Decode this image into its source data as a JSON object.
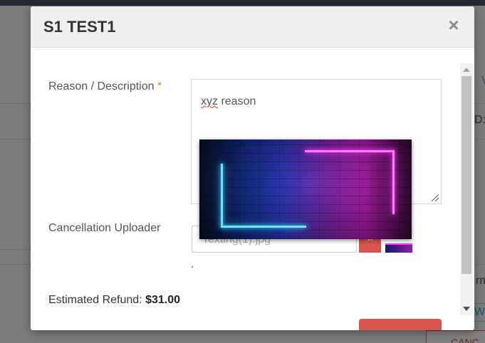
{
  "modal": {
    "title": "S1 TEST1",
    "close_symbol": "×"
  },
  "form": {
    "reason_label": "Reason / Description",
    "required_marker": "*",
    "reason_value_misspelled": "xyz",
    "reason_value_rest": " reason",
    "uploader_label": "Cancellation Uploader",
    "file_name": "Texting(1).jpg",
    "file_remove_symbol": "×"
  },
  "refund": {
    "label": "Estimated Refund: ",
    "amount": "$31.00"
  },
  "background": {
    "right_fragments": [
      "V",
      "D:",
      "rm",
      "W",
      "CANC"
    ]
  },
  "colors": {
    "danger": "#d9534f",
    "required": "#e67e22",
    "header_bg": "#efefef"
  },
  "icons": {
    "close": "close-icon",
    "remove": "remove-icon",
    "resize": "resize-grip-icon"
  }
}
